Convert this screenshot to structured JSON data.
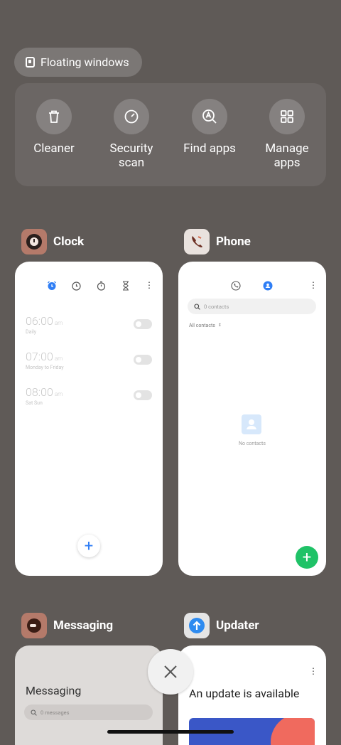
{
  "floating": {
    "label": "Floating windows"
  },
  "actions": [
    {
      "label": "Cleaner",
      "icon": "trash-icon"
    },
    {
      "label": "Security\nscan",
      "icon": "security-scan-icon"
    },
    {
      "label": "Find apps",
      "icon": "find-apps-icon"
    },
    {
      "label": "Manage\napps",
      "icon": "grid-icon"
    }
  ],
  "apps": {
    "clock": {
      "name": "Clock",
      "alarms": [
        {
          "time": "06:00",
          "ampm": "am",
          "repeat": "Daily"
        },
        {
          "time": "07:00",
          "ampm": "am",
          "repeat": "Monday to Friday"
        },
        {
          "time": "08:00",
          "ampm": "am",
          "repeat": "Sat Sun"
        }
      ]
    },
    "phone": {
      "name": "Phone",
      "search_placeholder": "0 contacts",
      "filter": "All contacts",
      "empty": "No contacts"
    },
    "messaging": {
      "name": "Messaging",
      "title": "Messaging",
      "search_placeholder": "0 messages"
    },
    "updater": {
      "name": "Updater",
      "title": "An update is available"
    }
  },
  "colors": {
    "accent_blue": "#2f7ef5",
    "fab_green": "#1fc267"
  }
}
